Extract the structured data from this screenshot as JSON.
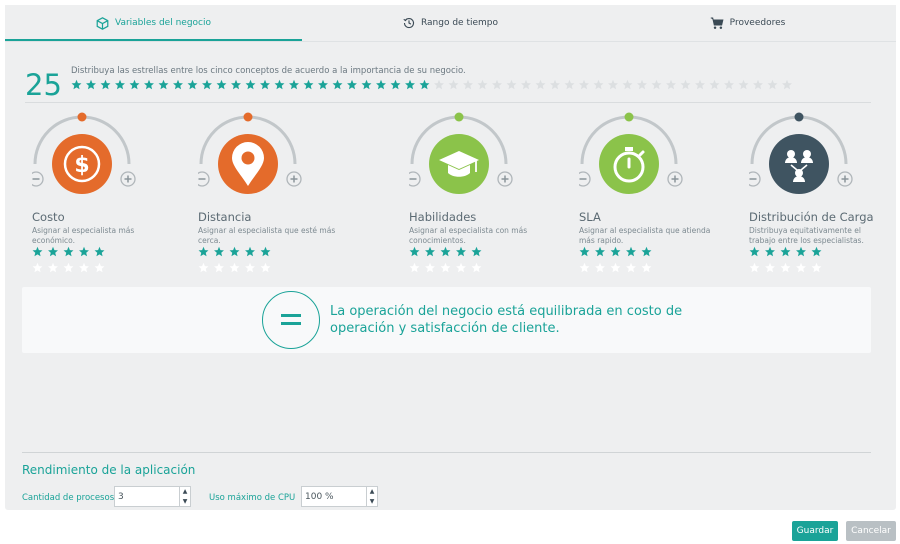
{
  "tabs": [
    {
      "label": "Variables del negocio",
      "icon": "cube-icon",
      "active": true
    },
    {
      "label": "Rango de tiempo",
      "icon": "history-icon",
      "active": false
    },
    {
      "label": "Proveedores",
      "icon": "cart-icon",
      "active": false
    }
  ],
  "distribution": {
    "count": "25",
    "instruction": "Distribuya las estrellas entre los cinco conceptos de acuerdo a la importancia de su negocio.",
    "stars_total": 50,
    "stars_filled": 25
  },
  "concepts": [
    {
      "title": "Costo",
      "description": "Asignar al especialista más económico.",
      "icon": "dollar-icon",
      "color": "#e46b2b",
      "stars": 5,
      "gauge_level": 0.5
    },
    {
      "title": "Distancia",
      "description": "Asignar al especialista que esté más cerca.",
      "icon": "map-pin-icon",
      "color": "#e46b2b",
      "stars": 5,
      "gauge_level": 0.5
    },
    {
      "title": "Habilidades",
      "description": "Asignar al especialista con más conocimientos.",
      "icon": "graduation-cap-icon",
      "color": "#8bc34a",
      "stars": 5,
      "gauge_level": 0.5
    },
    {
      "title": "SLA",
      "description": "Asignar al especialista que atienda más rapido.",
      "icon": "stopwatch-icon",
      "color": "#8bc34a",
      "stars": 5,
      "gauge_level": 0.5
    },
    {
      "title": "Distribución de Carga",
      "description": "Distribuya equitativamente el trabajo entre los especialistas.",
      "icon": "users-icon",
      "color": "#3f5461",
      "stars": 5,
      "gauge_level": 0.5
    }
  ],
  "banner": {
    "icon": "equals-icon",
    "text": "La operación del negocio está equilibrada en costo de operación y satisfacción de cliente."
  },
  "performance": {
    "title": "Rendimiento de la aplicación",
    "processes_label": "Cantidad de procesos",
    "processes_value": "3",
    "cpu_label": "Uso máximo de CPU",
    "cpu_value": "100 %"
  },
  "actions": {
    "save": "Guardar",
    "cancel": "Cancelar"
  },
  "colors": {
    "accent": "#1aa398",
    "orange": "#e46b2b",
    "green": "#8bc34a",
    "slate": "#3f5461"
  }
}
